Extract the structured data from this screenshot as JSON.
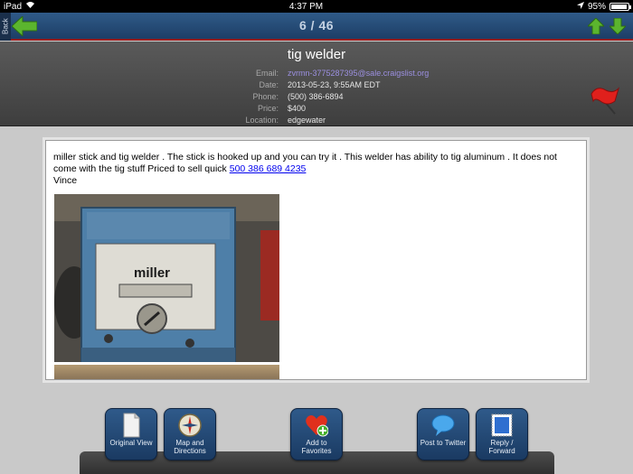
{
  "status_bar": {
    "device": "iPad",
    "time": "4:37 PM",
    "battery": "95%",
    "battery_level": 0.95
  },
  "nav": {
    "back_label": "Back",
    "counter": "6 / 46"
  },
  "listing": {
    "title": "tig welder",
    "fields": [
      {
        "label": "Email:",
        "value": "zvrmn-3775287395@sale.craigslist.org",
        "is_link": true
      },
      {
        "label": "Date:",
        "value": "2013-05-23,  9:55AM EDT",
        "is_link": false
      },
      {
        "label": "Phone:",
        "value": "(500) 386-6894",
        "is_link": false
      },
      {
        "label": "Price:",
        "value": "$400",
        "is_link": false
      },
      {
        "label": "Location:",
        "value": "edgewater",
        "is_link": false
      }
    ],
    "body_text": "miller stick and tig welder . The stick is hooked up and you can try it . This welder has ability to tig aluminum . It does not come with the tig stuff Priced to sell quick ",
    "phone_link": "500 386 689 4235",
    "signature": "Vince",
    "photo_brand": "miller"
  },
  "toolbar": {
    "original_view": "Original View",
    "map_directions": "Map and Directions",
    "add_favorites": "Add to Favorites",
    "post_twitter": "Post to Twitter",
    "reply_forward": "Reply / Forward"
  },
  "colors": {
    "nav_accent": "#1d3e66",
    "link": "#0000ee",
    "email_link": "#9b8fe0",
    "arrow_green": "#5bb52e"
  }
}
